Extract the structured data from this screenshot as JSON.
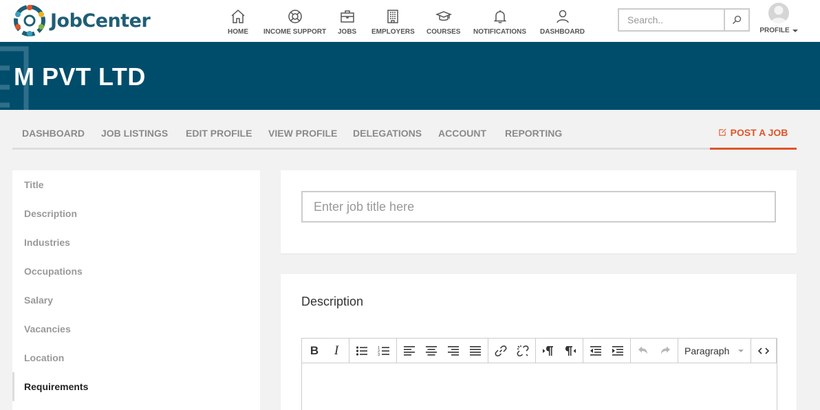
{
  "brand": {
    "name": "JobCenter",
    "accent": "#e0542a",
    "banner_color": "#004d6b",
    "logo_colors": [
      "#1f5e75",
      "#e0542a",
      "#f2b01e",
      "#3aa0c0",
      "#7cb342"
    ]
  },
  "nav": {
    "items": [
      {
        "label": "HOME",
        "icon": "home-icon"
      },
      {
        "label": "INCOME SUPPORT",
        "icon": "lifebuoy-icon"
      },
      {
        "label": "JOBS",
        "icon": "briefcase-icon"
      },
      {
        "label": "EMPLOYERS",
        "icon": "building-icon"
      },
      {
        "label": "COURSES",
        "icon": "graduation-cap-icon"
      },
      {
        "label": "NOTIFICATIONS",
        "icon": "bell-icon"
      },
      {
        "label": "DASHBOARD",
        "icon": "user-icon"
      }
    ],
    "search_placeholder": "Search..",
    "profile_label": "PROFILE"
  },
  "banner": {
    "title": "M PVT LTD"
  },
  "tabs": {
    "items": [
      "DASHBOARD",
      "JOB LISTINGS",
      "EDIT PROFILE",
      "VIEW PROFILE",
      "DELEGATIONS",
      "ACCOUNT",
      "REPORTING"
    ],
    "post_job": "POST A JOB"
  },
  "sidebar": {
    "items": [
      "Title",
      "Description",
      "Industries",
      "Occupations",
      "Salary",
      "Vacancies",
      "Location",
      "Requirements"
    ],
    "active": "Requirements"
  },
  "form": {
    "title_placeholder": "Enter job title here",
    "description_label": "Description",
    "editor": {
      "format_value": "Paragraph",
      "buttons": [
        "bold",
        "italic",
        "bullet-list",
        "numbered-list",
        "align-left",
        "align-center",
        "align-right",
        "align-justify",
        "link",
        "unlink",
        "ltr",
        "rtl",
        "outdent",
        "indent",
        "undo",
        "redo",
        "source-code"
      ]
    }
  }
}
